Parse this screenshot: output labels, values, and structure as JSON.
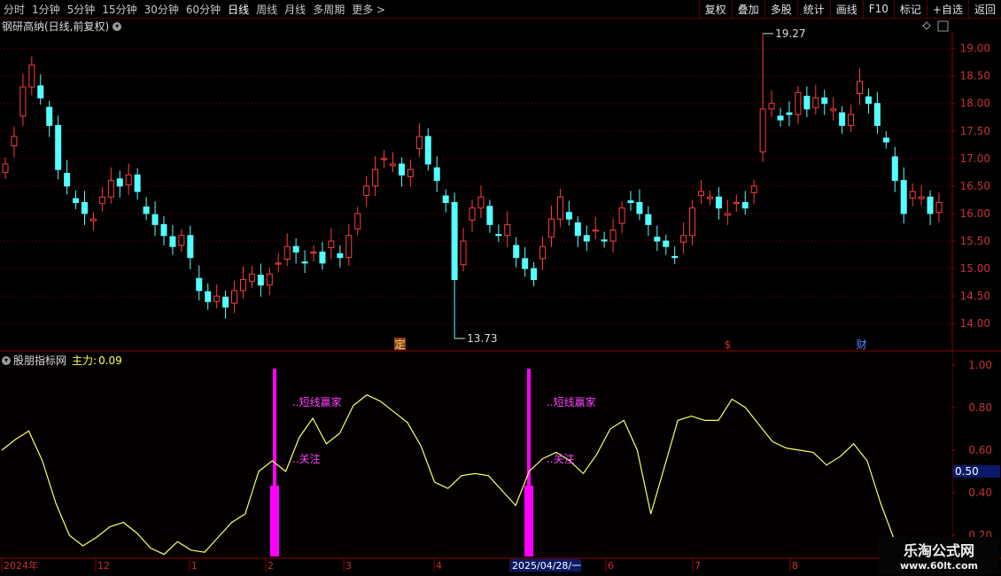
{
  "toolbar": {
    "periods": [
      "分时",
      "1分钟",
      "5分钟",
      "15分钟",
      "30分钟",
      "60分钟",
      "日线",
      "周线",
      "月线",
      "多周期",
      "更多"
    ],
    "active_period": "日线",
    "right_buttons": [
      "复权",
      "叠加",
      "多股",
      "统计",
      "画线",
      "F10",
      "标记",
      "+自选",
      "返回"
    ]
  },
  "stock": {
    "title": "钢研高纳(日线,前复权)",
    "max_label": "19.27",
    "min_label": "13.73",
    "event_markers": [
      "定",
      "$",
      "财"
    ]
  },
  "price_axis": [
    "19.00",
    "18.50",
    "18.00",
    "17.50",
    "17.00",
    "16.50",
    "16.00",
    "15.50",
    "15.00",
    "14.50",
    "14.00"
  ],
  "indicator": {
    "name": "股朋指标网",
    "main_label": "主力:",
    "main_value": "0.09",
    "axis": [
      "1.00",
      "0.80",
      "0.60",
      "0.40",
      "0.20"
    ],
    "current_value": "0.50",
    "signal_texts": [
      "短线赢家",
      "关注",
      "短线赢家",
      "关注"
    ]
  },
  "time_axis": [
    "2024年",
    "12",
    "1",
    "2",
    "3",
    "4",
    "2025/04/28/一",
    "6",
    "7",
    "8"
  ],
  "watermark": {
    "line1": "乐淘公式网",
    "line2": "www.60lt.com"
  },
  "chart_data": [
    {
      "type": "candlestick",
      "title": "钢研高纳(日线,前复权)",
      "ylim": [
        13.6,
        19.3
      ],
      "high": 19.27,
      "low": 13.73,
      "close_series": [
        16.9,
        17.4,
        18.3,
        18.7,
        18.1,
        17.6,
        16.8,
        16.5,
        16.2,
        16.0,
        15.9,
        16.3,
        16.6,
        16.5,
        16.7,
        16.4,
        16.0,
        15.8,
        15.6,
        15.4,
        15.6,
        15.2,
        14.6,
        14.4,
        14.5,
        14.3,
        14.6,
        14.8,
        14.9,
        14.7,
        14.9,
        15.1,
        15.4,
        15.3,
        15.1,
        15.3,
        15.1,
        15.5,
        15.2,
        15.6,
        16.0,
        16.5,
        16.8,
        17.0,
        16.9,
        16.7,
        16.8,
        17.4,
        16.9,
        16.6,
        16.2,
        14.8,
        15.5,
        16.1,
        16.3,
        15.8,
        15.6,
        15.8,
        15.2,
        15.0,
        14.8,
        15.4,
        15.9,
        16.3,
        15.9,
        15.6,
        15.5,
        15.7,
        15.5,
        15.7,
        16.1,
        16.2,
        16.0,
        15.8,
        15.5,
        15.4,
        15.2,
        15.6,
        16.1,
        16.4,
        16.3,
        16.1,
        16.0,
        16.2,
        16.1,
        16.5,
        17.9,
        18.0,
        17.7,
        17.8,
        18.2,
        17.9,
        18.1,
        18.0,
        17.9,
        17.6,
        17.8,
        18.4,
        18.0,
        17.6,
        17.3,
        16.6,
        16.0,
        16.4,
        16.3,
        16.0,
        16.2
      ]
    },
    {
      "type": "line",
      "series": [
        {
          "name": "主力",
          "values": [
            0.6,
            0.65,
            0.69,
            0.55,
            0.35,
            0.2,
            0.15,
            0.19,
            0.24,
            0.26,
            0.21,
            0.14,
            0.11,
            0.17,
            0.13,
            0.12,
            0.19,
            0.26,
            0.3,
            0.5,
            0.55,
            0.5,
            0.66,
            0.75,
            0.63,
            0.68,
            0.81,
            0.86,
            0.83,
            0.78,
            0.73,
            0.62,
            0.45,
            0.42,
            0.48,
            0.49,
            0.48,
            0.41,
            0.34,
            0.5,
            0.56,
            0.59,
            0.55,
            0.49,
            0.58,
            0.7,
            0.74,
            0.6,
            0.3,
            0.52,
            0.74,
            0.76,
            0.74,
            0.74,
            0.84,
            0.8,
            0.72,
            0.64,
            0.61,
            0.6,
            0.59,
            0.53,
            0.57,
            0.63,
            0.55,
            0.35,
            0.18,
            0.14,
            0.12
          ]
        }
      ],
      "ylim": [
        0.1,
        1.05
      ],
      "current": 0.5
    }
  ]
}
